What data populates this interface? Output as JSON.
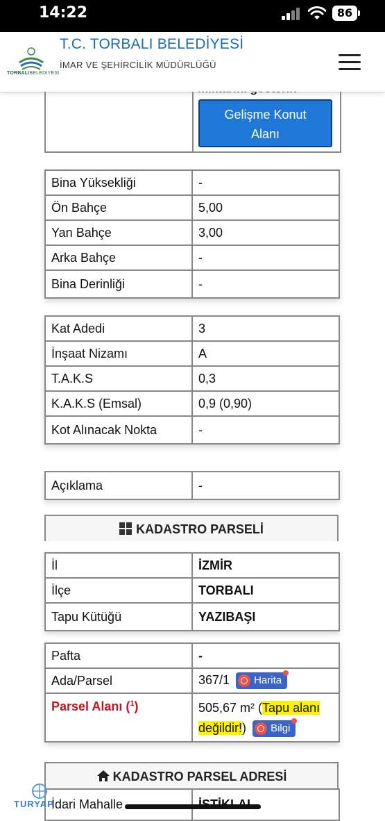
{
  "status_bar": {
    "time": "14:22",
    "battery": "86"
  },
  "header": {
    "title": "T.C. TORBALI BELEDİYESİ",
    "subtitle": "İMAR VE ŞEHİRCİLİK MÜDÜRLÜĞÜ",
    "logo_text_a": "TORBALI",
    "logo_text_b": "BELEDİYESİ"
  },
  "top_section": {
    "cut_text": "miktarını gösterin",
    "button_line1": "Gelişme Konut",
    "button_line2": "Alanı"
  },
  "building_table": [
    {
      "label": "Bina Yüksekliği",
      "value": "-"
    },
    {
      "label": "Ön Bahçe",
      "value": "5,00"
    },
    {
      "label": "Yan Bahçe",
      "value": "3,00"
    },
    {
      "label": "Arka Bahçe",
      "value": "-"
    },
    {
      "label": "Bina Derinliği",
      "value": "-"
    }
  ],
  "floor_table": [
    {
      "label": "Kat Adedi",
      "value": "3"
    },
    {
      "label": "İnşaat Nizamı",
      "value": "A"
    },
    {
      "label": "T.A.K.S",
      "value": "0,3"
    },
    {
      "label": "K.A.K.S (Emsal)",
      "value": "0,9 (0,90)"
    },
    {
      "label": "Kot Alınacak Nokta",
      "value": "-"
    }
  ],
  "note_table": [
    {
      "label": "Açıklama",
      "value": "-"
    }
  ],
  "kadastro": {
    "heading": "KADASTRO PARSELİ",
    "location_rows": [
      {
        "label": "İl",
        "value": "İZMİR"
      },
      {
        "label": "İlçe",
        "value": "TORBALI"
      },
      {
        "label": "Tapu Kütüğü",
        "value": "YAZIBAŞI"
      }
    ],
    "pafta_label": "Pafta",
    "pafta_value": "-",
    "ada_label": "Ada/Parsel",
    "ada_value": "367/1",
    "map_button": "Harita",
    "area_label": "Parsel Alanı (",
    "area_sup": "1",
    "area_label_end": ")",
    "area_value": "505,67 m²",
    "area_open": " (",
    "area_note_1": "Tapu alanı",
    "area_note_2": "değildir!",
    "area_close": ")",
    "info_button": "Bilgi"
  },
  "address": {
    "heading": "KADASTRO PARSEL ADRESİ",
    "row_label": "İdari Mahalle",
    "row_value": "İSTİKLAL"
  },
  "brand_watermark": "TURYAP"
}
